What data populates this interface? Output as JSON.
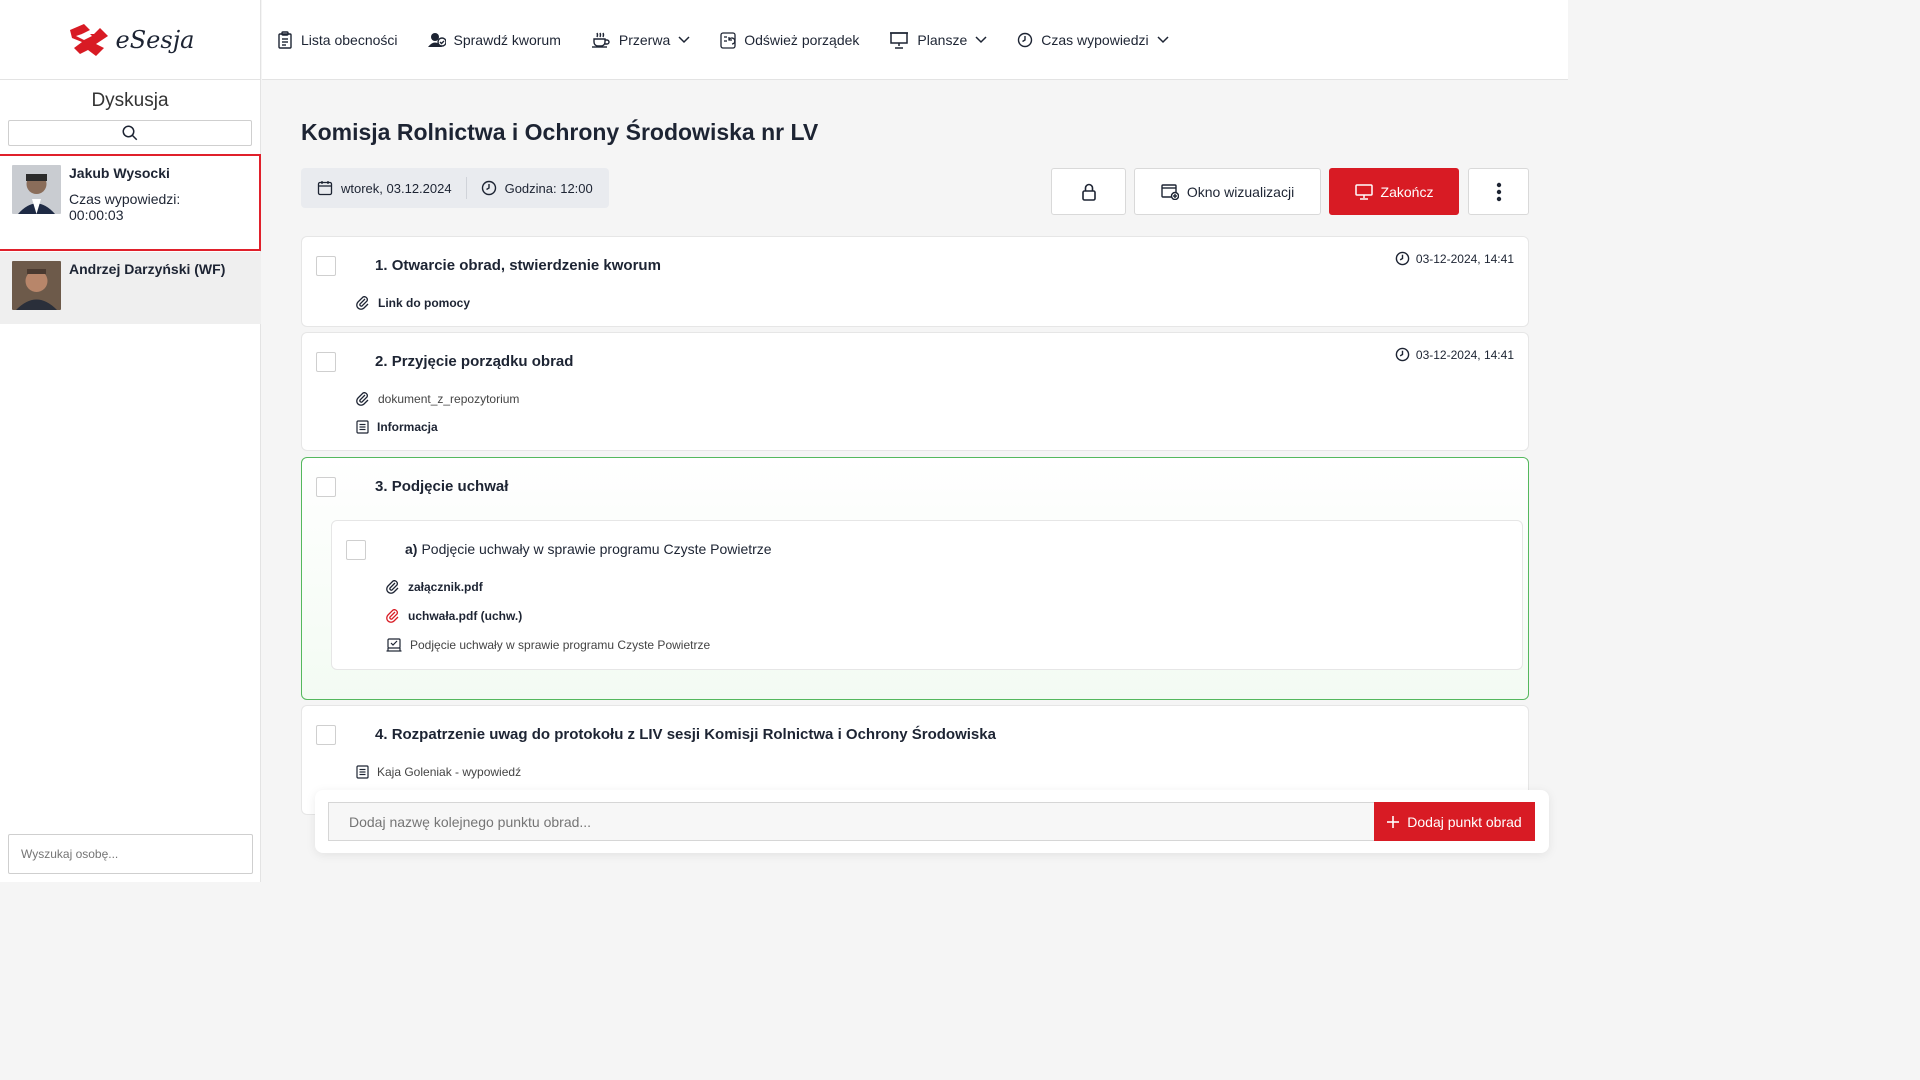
{
  "app": {
    "logo_text": "eSesja"
  },
  "topbar": {
    "items": [
      {
        "label": "Lista obecności",
        "icon": "clipboard-icon"
      },
      {
        "label": "Sprawdź kworum",
        "icon": "user-check-icon"
      },
      {
        "label": "Przerwa",
        "icon": "coffee-icon",
        "dropdown": true
      },
      {
        "label": "Odśwież porządek",
        "icon": "refresh-list-icon"
      },
      {
        "label": "Plansze",
        "icon": "presentation-icon",
        "dropdown": true
      },
      {
        "label": "Czas wypowiedzi",
        "icon": "clock-icon",
        "dropdown": true
      }
    ]
  },
  "sidebar": {
    "title": "Dyskusja",
    "speakers": [
      {
        "name": "Jakub Wysocki",
        "time_label": "Czas wypowiedzi:",
        "time": "00:00:03"
      },
      {
        "name": "Andrzej  Darzyński (WF)"
      }
    ],
    "person_search_placeholder": "Wyszukaj osobę..."
  },
  "session": {
    "title": "Komisja Rolnictwa i Ochrony Środowiska nr LV",
    "date": "wtorek, 03.12.2024",
    "time": "Godzina: 12:00",
    "buttons": {
      "visualization": "Okno wizualizacji",
      "end": "Zakończ"
    }
  },
  "agenda": [
    {
      "number": "1.",
      "title": "Otwarcie obrad, stwierdzenie kworum",
      "timestamp": "03-12-2024, 14:41",
      "attachments": [
        {
          "label": "Link do pomocy",
          "icon": "paperclip-icon"
        }
      ]
    },
    {
      "number": "2.",
      "title": "Przyjęcie porządku obrad",
      "timestamp": "03-12-2024, 14:41",
      "attachments": [
        {
          "label": "dokument_z_repozytorium",
          "icon": "paperclip-icon"
        },
        {
          "label": "Informacja",
          "icon": "document-icon"
        }
      ]
    },
    {
      "number": "3.",
      "title": "Podjęcie uchwał",
      "subitems": [
        {
          "letter": "a)",
          "title": "Podjęcie uchwały w sprawie programu Czyste Powietrze",
          "attachments": [
            {
              "label": "załącznik.pdf",
              "icon": "paperclip-icon"
            },
            {
              "label": "uchwała.pdf (uchw.)",
              "icon": "paperclip-red-icon"
            },
            {
              "label": "Podjęcie uchwały w sprawie programu Czyste Powietrze",
              "icon": "vote-icon"
            }
          ]
        }
      ]
    },
    {
      "number": "4.",
      "title": "Rozpatrzenie uwag do protokołu z LIV sesji Komisji Rolnictwa i Ochrony Środowiska",
      "attachments": [
        {
          "label": "Kaja Goleniak - wypowiedź",
          "icon": "document-icon"
        }
      ]
    }
  ],
  "add_item": {
    "placeholder": "Dodaj nazwę kolejnego punktu obrad...",
    "button": "Dodaj punkt obrad"
  },
  "colors": {
    "accent_red": "#d81b24",
    "active_green": "#54b85d"
  }
}
